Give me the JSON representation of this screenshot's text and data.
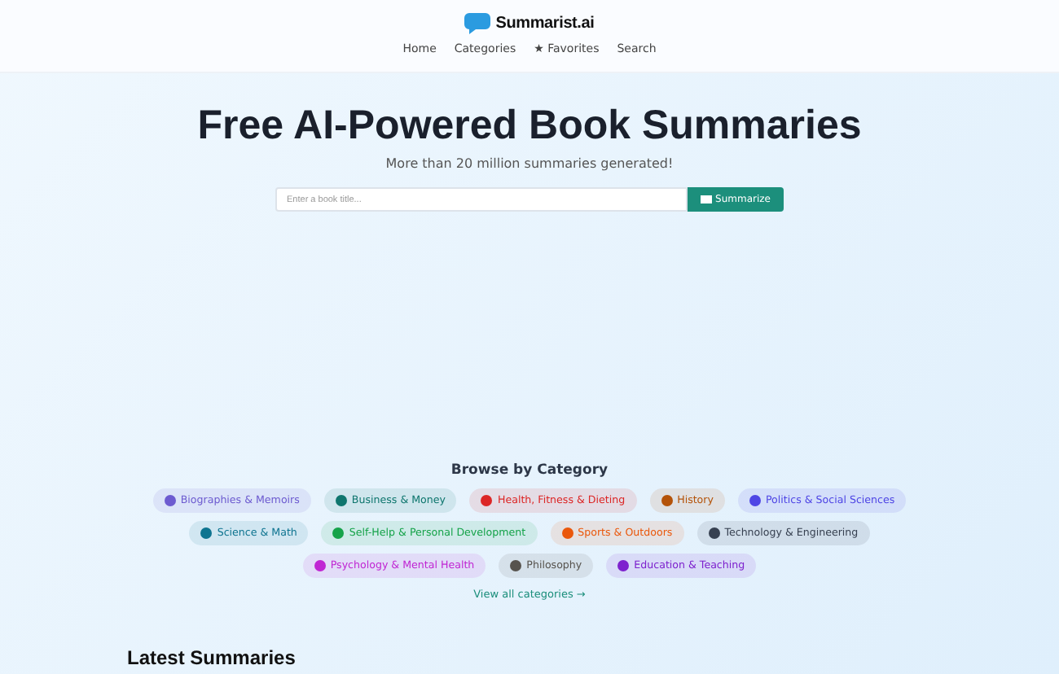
{
  "header": {
    "logo_text": "Summarist.ai",
    "nav": [
      {
        "label": "Home"
      },
      {
        "label": "Categories"
      },
      {
        "label": "★ Favorites"
      },
      {
        "label": "Search"
      }
    ]
  },
  "hero": {
    "title": "Free AI-Powered Book Summaries",
    "subtitle": "More than 20 million summaries generated!",
    "search": {
      "placeholder": "Enter a book title...",
      "button": "Summarize"
    }
  },
  "categories": {
    "heading": "Browse by Category",
    "items": [
      {
        "label": "Biographies & Memoirs",
        "color": "#6d5bd0"
      },
      {
        "label": "Business & Money",
        "color": "#0f766e"
      },
      {
        "label": "Health, Fitness & Dieting",
        "color": "#dc2626"
      },
      {
        "label": "History",
        "color": "#b45309"
      },
      {
        "label": "Politics & Social Sciences",
        "color": "#4f46e5"
      },
      {
        "label": "Science & Math",
        "color": "#0e7490"
      },
      {
        "label": "Self-Help & Personal Development",
        "color": "#16a34a"
      },
      {
        "label": "Sports & Outdoors",
        "color": "#ea580c"
      },
      {
        "label": "Technology & Engineering",
        "color": "#374151"
      },
      {
        "label": "Psychology & Mental Health",
        "color": "#c026d3"
      },
      {
        "label": "Philosophy",
        "color": "#57534e"
      },
      {
        "label": "Education & Teaching",
        "color": "#7e22ce"
      }
    ],
    "view_all": "View all categories →"
  },
  "latest": {
    "heading": "Latest Summaries"
  }
}
